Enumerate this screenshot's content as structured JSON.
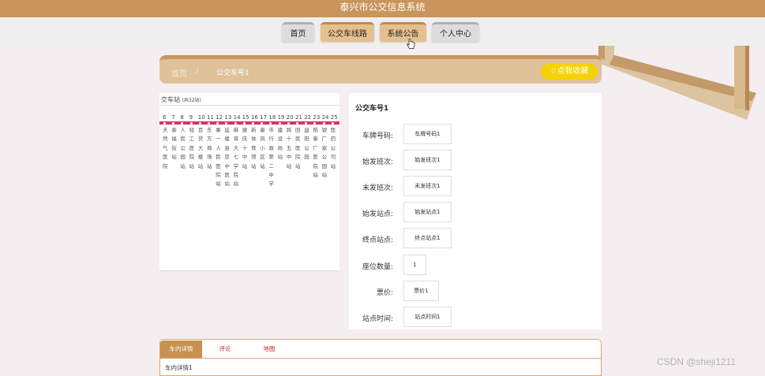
{
  "header": {
    "title": "泰兴市公交信息系统"
  },
  "nav": {
    "items": [
      "首页",
      "公交车线路",
      "系统公告",
      "个人中心"
    ],
    "active_index": 1
  },
  "breadcrumb": {
    "home": "首页",
    "separator": "/",
    "current": "公交车号1",
    "favorite_label": "☆点我收藏"
  },
  "route": {
    "title": "交车站",
    "count_text": "(共32站)",
    "stop_numbers": [
      "6",
      "7",
      "8",
      "9",
      "10",
      "11",
      "12",
      "13",
      "14",
      "15",
      "16",
      "17",
      "18",
      "19",
      "20",
      "21",
      "22",
      "23",
      "24",
      "25"
    ],
    "stop_names": [
      "天然气医院",
      "泰福街站",
      "人民公园站",
      "轻工医院站",
      "百货大楼站",
      "东方商场站",
      "果一人民医院站",
      "延缓县亚中医站",
      "麻将大七学院站",
      "捷庆十中站",
      "新体育馆站",
      "秦风小区站",
      "市行政第二中学",
      "建设局站",
      "跨十五中站",
      "回民医院站",
      "益阳公园",
      "稻泰厂医院站",
      "银厂家公园站",
      "医药公司站"
    ],
    "line_color": "#d9336a"
  },
  "detail": {
    "title": "公交车号1",
    "fields": [
      {
        "label": "车牌号码:",
        "value": "车牌号码1"
      },
      {
        "label": "始发班次:",
        "value": "始发班次1"
      },
      {
        "label": "末发班次:",
        "value": "末发班次1"
      },
      {
        "label": "始发站点:",
        "value": "始发站点1"
      },
      {
        "label": "终点站点:",
        "value": "终点站点1"
      },
      {
        "label": "座位数量:",
        "value": "1"
      },
      {
        "label": "票价:",
        "value": "票价1"
      },
      {
        "label": "站点时间:",
        "value": "站点时间1"
      }
    ]
  },
  "tabs": {
    "items": [
      "车内详情",
      "评论",
      "地图"
    ],
    "active_index": 0,
    "content": "车内详情1"
  },
  "watermark": "CSDN @sheji1211",
  "colors": {
    "topbar": "#c9955a",
    "accent": "#c8914f",
    "favorite": "#f5d100",
    "route_line": "#d9336a"
  }
}
